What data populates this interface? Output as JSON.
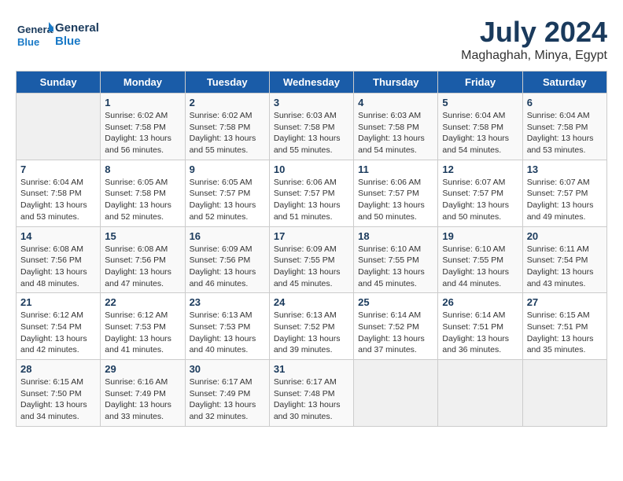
{
  "header": {
    "logo_line1": "General",
    "logo_line2": "Blue",
    "month_year": "July 2024",
    "location": "Maghaghah, Minya, Egypt"
  },
  "weekdays": [
    "Sunday",
    "Monday",
    "Tuesday",
    "Wednesday",
    "Thursday",
    "Friday",
    "Saturday"
  ],
  "weeks": [
    [
      {
        "day": "",
        "info": ""
      },
      {
        "day": "1",
        "info": "Sunrise: 6:02 AM\nSunset: 7:58 PM\nDaylight: 13 hours\nand 56 minutes."
      },
      {
        "day": "2",
        "info": "Sunrise: 6:02 AM\nSunset: 7:58 PM\nDaylight: 13 hours\nand 55 minutes."
      },
      {
        "day": "3",
        "info": "Sunrise: 6:03 AM\nSunset: 7:58 PM\nDaylight: 13 hours\nand 55 minutes."
      },
      {
        "day": "4",
        "info": "Sunrise: 6:03 AM\nSunset: 7:58 PM\nDaylight: 13 hours\nand 54 minutes."
      },
      {
        "day": "5",
        "info": "Sunrise: 6:04 AM\nSunset: 7:58 PM\nDaylight: 13 hours\nand 54 minutes."
      },
      {
        "day": "6",
        "info": "Sunrise: 6:04 AM\nSunset: 7:58 PM\nDaylight: 13 hours\nand 53 minutes."
      }
    ],
    [
      {
        "day": "7",
        "info": "Sunrise: 6:04 AM\nSunset: 7:58 PM\nDaylight: 13 hours\nand 53 minutes."
      },
      {
        "day": "8",
        "info": "Sunrise: 6:05 AM\nSunset: 7:58 PM\nDaylight: 13 hours\nand 52 minutes."
      },
      {
        "day": "9",
        "info": "Sunrise: 6:05 AM\nSunset: 7:57 PM\nDaylight: 13 hours\nand 52 minutes."
      },
      {
        "day": "10",
        "info": "Sunrise: 6:06 AM\nSunset: 7:57 PM\nDaylight: 13 hours\nand 51 minutes."
      },
      {
        "day": "11",
        "info": "Sunrise: 6:06 AM\nSunset: 7:57 PM\nDaylight: 13 hours\nand 50 minutes."
      },
      {
        "day": "12",
        "info": "Sunrise: 6:07 AM\nSunset: 7:57 PM\nDaylight: 13 hours\nand 50 minutes."
      },
      {
        "day": "13",
        "info": "Sunrise: 6:07 AM\nSunset: 7:57 PM\nDaylight: 13 hours\nand 49 minutes."
      }
    ],
    [
      {
        "day": "14",
        "info": "Sunrise: 6:08 AM\nSunset: 7:56 PM\nDaylight: 13 hours\nand 48 minutes."
      },
      {
        "day": "15",
        "info": "Sunrise: 6:08 AM\nSunset: 7:56 PM\nDaylight: 13 hours\nand 47 minutes."
      },
      {
        "day": "16",
        "info": "Sunrise: 6:09 AM\nSunset: 7:56 PM\nDaylight: 13 hours\nand 46 minutes."
      },
      {
        "day": "17",
        "info": "Sunrise: 6:09 AM\nSunset: 7:55 PM\nDaylight: 13 hours\nand 45 minutes."
      },
      {
        "day": "18",
        "info": "Sunrise: 6:10 AM\nSunset: 7:55 PM\nDaylight: 13 hours\nand 45 minutes."
      },
      {
        "day": "19",
        "info": "Sunrise: 6:10 AM\nSunset: 7:55 PM\nDaylight: 13 hours\nand 44 minutes."
      },
      {
        "day": "20",
        "info": "Sunrise: 6:11 AM\nSunset: 7:54 PM\nDaylight: 13 hours\nand 43 minutes."
      }
    ],
    [
      {
        "day": "21",
        "info": "Sunrise: 6:12 AM\nSunset: 7:54 PM\nDaylight: 13 hours\nand 42 minutes."
      },
      {
        "day": "22",
        "info": "Sunrise: 6:12 AM\nSunset: 7:53 PM\nDaylight: 13 hours\nand 41 minutes."
      },
      {
        "day": "23",
        "info": "Sunrise: 6:13 AM\nSunset: 7:53 PM\nDaylight: 13 hours\nand 40 minutes."
      },
      {
        "day": "24",
        "info": "Sunrise: 6:13 AM\nSunset: 7:52 PM\nDaylight: 13 hours\nand 39 minutes."
      },
      {
        "day": "25",
        "info": "Sunrise: 6:14 AM\nSunset: 7:52 PM\nDaylight: 13 hours\nand 37 minutes."
      },
      {
        "day": "26",
        "info": "Sunrise: 6:14 AM\nSunset: 7:51 PM\nDaylight: 13 hours\nand 36 minutes."
      },
      {
        "day": "27",
        "info": "Sunrise: 6:15 AM\nSunset: 7:51 PM\nDaylight: 13 hours\nand 35 minutes."
      }
    ],
    [
      {
        "day": "28",
        "info": "Sunrise: 6:15 AM\nSunset: 7:50 PM\nDaylight: 13 hours\nand 34 minutes."
      },
      {
        "day": "29",
        "info": "Sunrise: 6:16 AM\nSunset: 7:49 PM\nDaylight: 13 hours\nand 33 minutes."
      },
      {
        "day": "30",
        "info": "Sunrise: 6:17 AM\nSunset: 7:49 PM\nDaylight: 13 hours\nand 32 minutes."
      },
      {
        "day": "31",
        "info": "Sunrise: 6:17 AM\nSunset: 7:48 PM\nDaylight: 13 hours\nand 30 minutes."
      },
      {
        "day": "",
        "info": ""
      },
      {
        "day": "",
        "info": ""
      },
      {
        "day": "",
        "info": ""
      }
    ]
  ]
}
